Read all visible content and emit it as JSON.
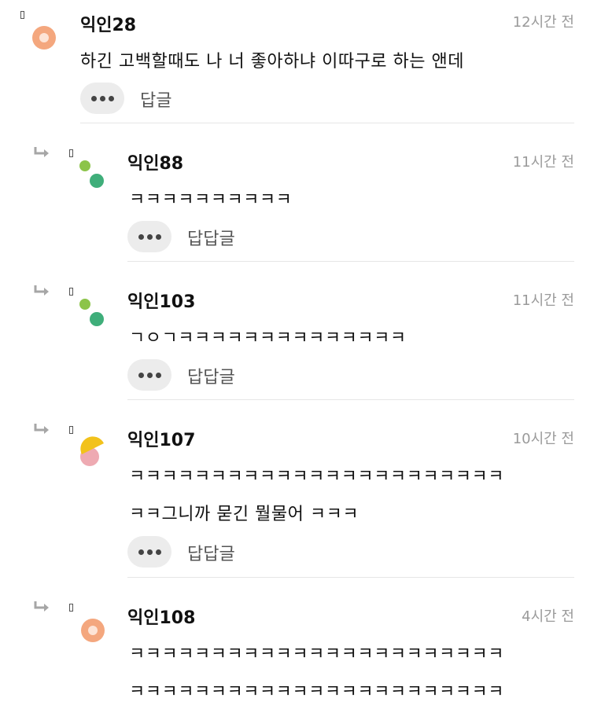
{
  "comments": [
    {
      "nick": "익인28",
      "time": "12시간 전",
      "lines": [
        "하긴 고백할때도 나 너 좋아하냐 이따구로 하는 앤데"
      ],
      "reply_label": "답글"
    },
    {
      "nick": "익인88",
      "time": "11시간 전",
      "lines": [
        "ㅋㅋㅋㅋㅋㅋㅋㅋㅋㅋ"
      ],
      "reply_label": "답답글"
    },
    {
      "nick": "익인103",
      "time": "11시간 전",
      "lines": [
        "ㄱㅇㄱㅋㅋㅋㅋㅋㅋㅋㅋㅋㅋㅋㅋㅋㅋ"
      ],
      "reply_label": "답답글"
    },
    {
      "nick": "익인107",
      "time": "10시간 전",
      "lines": [
        "ㅋㅋㅋㅋㅋㅋㅋㅋㅋㅋㅋㅋㅋㅋㅋㅋㅋㅋㅋㅋㅋㅋㅋ",
        "ㅋㅋ그니까 묻긴 뭘물어 ㅋㅋㅋ"
      ],
      "reply_label": "답답글"
    },
    {
      "nick": "익인108",
      "time": "4시간 전",
      "lines": [
        "ㅋㅋㅋㅋㅋㅋㅋㅋㅋㅋㅋㅋㅋㅋㅋㅋㅋㅋㅋㅋㅋㅋㅋ",
        "ㅋㅋㅋㅋㅋㅋㅋㅋㅋㅋㅋㅋㅋㅋㅋㅋㅋㅋㅋㅋㅋㅋㅋ"
      ]
    }
  ],
  "icons": {
    "more": "more-dots-icon",
    "reply_arrow": "reply-arrow-icon",
    "avatar_colors": {
      "orange": "#f4a77e",
      "green_light": "#8cc44a",
      "green_dark": "#3fae7a",
      "yellow": "#f2c21b",
      "pink": "#eeaab2"
    }
  }
}
